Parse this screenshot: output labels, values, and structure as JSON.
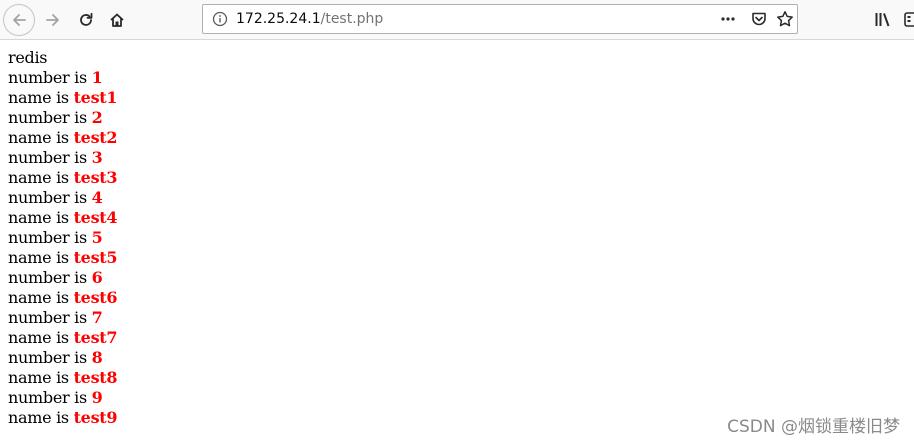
{
  "browser": {
    "url_host": "172.25.24.1",
    "url_path": "/test.php",
    "icons": [
      "back-icon",
      "forward-icon",
      "reload-icon",
      "home-icon",
      "info-icon",
      "more-icon",
      "pocket-icon",
      "star-icon",
      "library-icon",
      "sidebar-icon"
    ]
  },
  "page": {
    "heading": "redis",
    "number_label": "number is ",
    "name_label": "name is ",
    "records": [
      {
        "number": "1",
        "name": "test1"
      },
      {
        "number": "2",
        "name": "test2"
      },
      {
        "number": "3",
        "name": "test3"
      },
      {
        "number": "4",
        "name": "test4"
      },
      {
        "number": "5",
        "name": "test5"
      },
      {
        "number": "6",
        "name": "test6"
      },
      {
        "number": "7",
        "name": "test7"
      },
      {
        "number": "8",
        "name": "test8"
      },
      {
        "number": "9",
        "name": "test9"
      }
    ],
    "value_color": "#ff0000"
  },
  "watermark": "CSDN @烟锁重楼旧梦"
}
